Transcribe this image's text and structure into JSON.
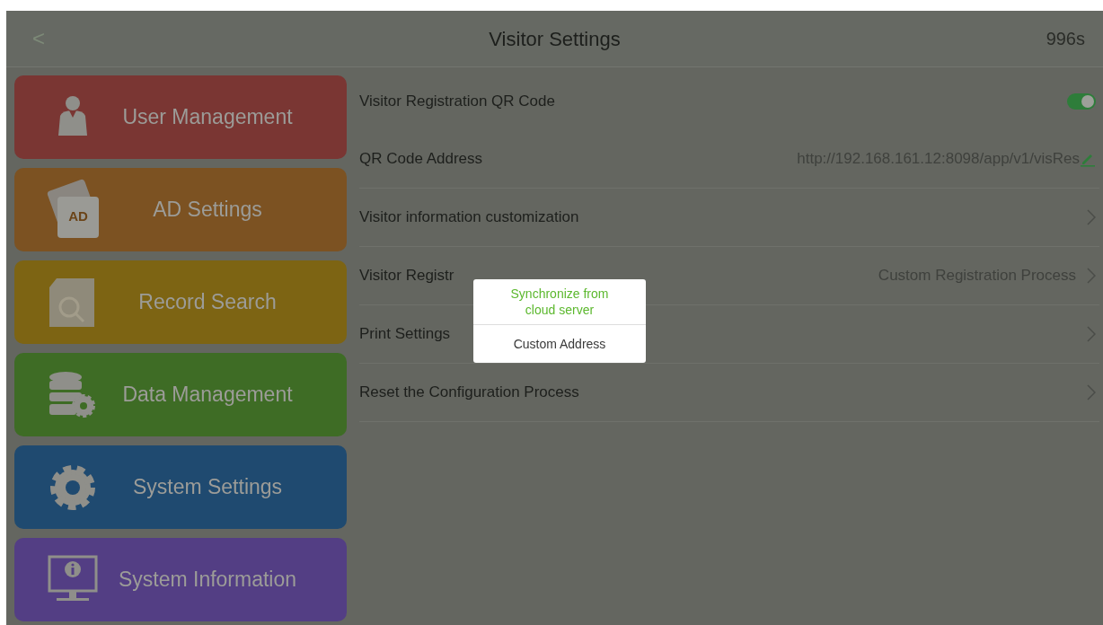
{
  "header": {
    "back": "<",
    "title": "Visitor Settings",
    "countdown": "996s"
  },
  "sidebar": {
    "items": [
      {
        "label": "User Management",
        "color": "#7a3633"
      },
      {
        "label": "AD Settings",
        "icon_text": "AD",
        "color": "#7c5222"
      },
      {
        "label": "Record Search",
        "color": "#7d6413"
      },
      {
        "label": "Data Management",
        "color": "#3e6c25"
      },
      {
        "label": "System Settings",
        "color": "#1f4a70"
      },
      {
        "label": "System Information",
        "color": "#533e84"
      }
    ]
  },
  "settings": [
    {
      "kind": "toggle",
      "label": "Visitor Registration QR Code",
      "on": true
    },
    {
      "kind": "edit",
      "label": "QR Code Address",
      "value": "http://192.168.161.12:8098/app/v1/visRes"
    },
    {
      "kind": "link",
      "label": "Visitor information customization"
    },
    {
      "kind": "link",
      "label": "Visitor Registr",
      "value": "Custom Registration Process"
    },
    {
      "kind": "link",
      "label": "Print Settings"
    },
    {
      "kind": "link",
      "label": "Reset the Configuration Process"
    }
  ],
  "popup_menu": [
    {
      "label": "Synchronize from cloud server",
      "selected": true
    },
    {
      "label": "Custom Address",
      "selected": false
    }
  ]
}
